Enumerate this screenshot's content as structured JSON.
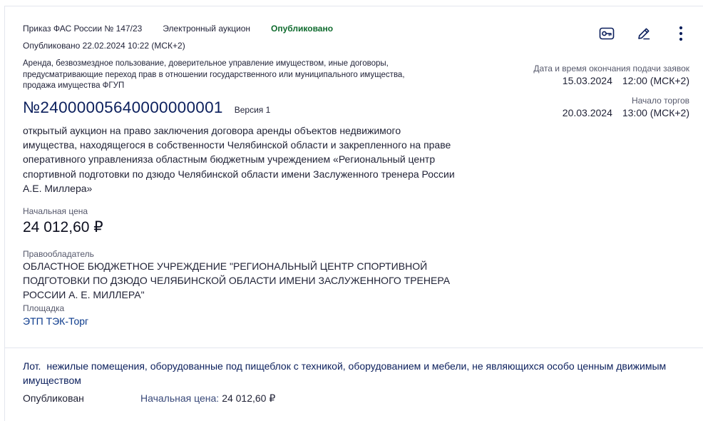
{
  "header": {
    "order": "Приказ ФАС России № 147/23",
    "auction_type": "Электронный аукцион",
    "status": "Опубликовано",
    "published": "Опубликовано 22.02.2024 10:22 (МСК+2)"
  },
  "category": "Аренда, безвозмездное пользование, доверительное управление имуществом, иные договоры, предусматривающие переход прав в отношении государственного или муниципального имущества, продажа имущества ФГУП",
  "lot_number": "№24000005640000000001",
  "version": "Версия 1",
  "description": "открытый аукцион на право заключения договора аренды объектов недвижимого имущества, находящегося в собственности Челябинской области и закрепленного на праве оперативного управленияза областным бюджетным учреждением «Региональный центр спортивной подготовки по дзюдо Челябинской области имени Заслуженного тренера России А.Е. Миллера»",
  "price": {
    "label": "Начальная цена",
    "value": "24 012,60 ₽"
  },
  "holder": {
    "label": "Правообладатель",
    "name": "ОБЛАСТНОЕ БЮДЖЕТНОЕ УЧРЕЖДЕНИЕ \"РЕГИОНАЛЬНЫЙ ЦЕНТР СПОРТИВНОЙ ПОДГОТОВКИ ПО ДЗЮДО ЧЕЛЯБИНСКОЙ ОБЛАСТИ ИМЕНИ ЗАСЛУЖЕННОГО ТРЕНЕРА РОССИИ А. Е. МИЛЛЕРА\""
  },
  "platform": {
    "label": "Площадка",
    "name": "ЭТП ТЭК-Торг"
  },
  "dates": {
    "application_end_label": "Дата и время окончания подачи заявок",
    "application_end_date": "15.03.2024",
    "application_end_time": "12:00 (МСК+2)",
    "trading_start_label": "Начало торгов",
    "trading_start_date": "20.03.2024",
    "trading_start_time": "13:00 (МСК+2)"
  },
  "icons": [
    "key-icon",
    "edit-icon",
    "more-vertical-icon"
  ],
  "lot": {
    "prefix": "Лот.",
    "description": "нежилые помещения, оборудованные под пищеблок с техникой, оборудованием и мебели, не являющихся особо ценным движимым имуществом",
    "status": "Опубликован",
    "price_label": "Начальная цена:",
    "price_value": "24 012,60 ₽"
  }
}
